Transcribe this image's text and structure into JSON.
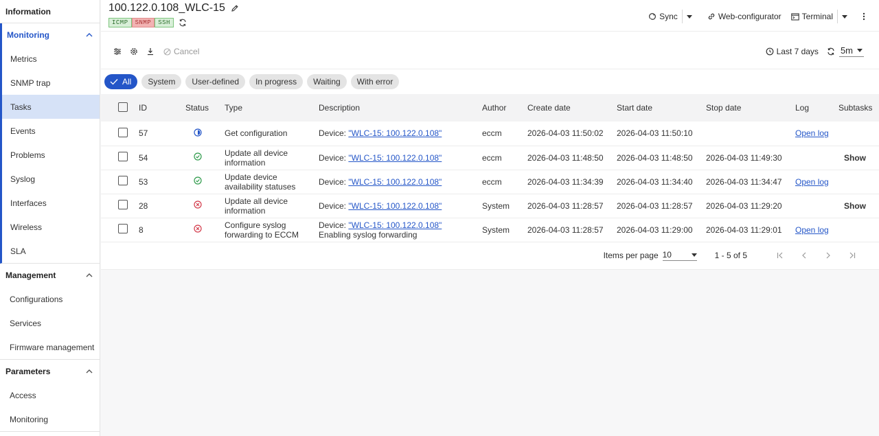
{
  "sidebar": {
    "information": "Information",
    "monitoring": {
      "title": "Monitoring",
      "items": [
        "Metrics",
        "SNMP trap",
        "Tasks",
        "Events",
        "Problems",
        "Syslog",
        "Interfaces",
        "Wireless",
        "SLA"
      ],
      "selected": "Tasks"
    },
    "management": {
      "title": "Management",
      "items": [
        "Configurations",
        "Services",
        "Firmware management"
      ]
    },
    "parameters": {
      "title": "Parameters",
      "items": [
        "Access",
        "Monitoring"
      ]
    }
  },
  "header": {
    "title": "100.122.0.108_WLC-15",
    "badges": [
      {
        "label": "ICMP",
        "status": "ok"
      },
      {
        "label": "SNMP",
        "status": "error"
      },
      {
        "label": "SSH",
        "status": "ok"
      }
    ],
    "sync_label": "Sync",
    "web_configurator_label": "Web-configurator",
    "terminal_label": "Terminal"
  },
  "toolbar": {
    "cancel_label": "Cancel",
    "period_label": "Last 7 days",
    "interval_value": "5m"
  },
  "filters": [
    "All",
    "System",
    "User-defined",
    "In progress",
    "Waiting",
    "With error"
  ],
  "active_filter": "All",
  "table": {
    "columns": [
      "ID",
      "Status",
      "Type",
      "Description",
      "Author",
      "Create date",
      "Start date",
      "Stop date",
      "Log",
      "Subtasks"
    ],
    "rows": [
      {
        "id": "57",
        "status": "in-progress",
        "type": "Get configuration",
        "desc_prefix": "Device: ",
        "desc_link": "\"WLC-15: 100.122.0.108\"",
        "desc_extra": "",
        "author": "eccm",
        "create": "2026-04-03 11:50:02",
        "start": "2026-04-03 11:50:10",
        "stop": "",
        "log": "Open log",
        "subtasks": ""
      },
      {
        "id": "54",
        "status": "success",
        "type": "Update all device information",
        "desc_prefix": "Device: ",
        "desc_link": "\"WLC-15: 100.122.0.108\"",
        "desc_extra": "",
        "author": "eccm",
        "create": "2026-04-03 11:48:50",
        "start": "2026-04-03 11:48:50",
        "stop": "2026-04-03 11:49:30",
        "log": "",
        "subtasks": "Show"
      },
      {
        "id": "53",
        "status": "success",
        "type": "Update device availability statuses",
        "desc_prefix": "Device: ",
        "desc_link": "\"WLC-15: 100.122.0.108\"",
        "desc_extra": "",
        "author": "eccm",
        "create": "2026-04-03 11:34:39",
        "start": "2026-04-03 11:34:40",
        "stop": "2026-04-03 11:34:47",
        "log": "Open log",
        "subtasks": ""
      },
      {
        "id": "28",
        "status": "error",
        "type": "Update all device information",
        "desc_prefix": "Device: ",
        "desc_link": "\"WLC-15: 100.122.0.108\"",
        "desc_extra": "",
        "author": "System",
        "create": "2026-04-03 11:28:57",
        "start": "2026-04-03 11:28:57",
        "stop": "2026-04-03 11:29:20",
        "log": "",
        "subtasks": "Show"
      },
      {
        "id": "8",
        "status": "error",
        "type": "Configure syslog forwarding to ECCM",
        "desc_prefix": "Device: ",
        "desc_link": "\"WLC-15: 100.122.0.108\"",
        "desc_extra": "Enabling syslog forwarding",
        "author": "System",
        "create": "2026-04-03 11:28:57",
        "start": "2026-04-03 11:29:00",
        "stop": "2026-04-03 11:29:01",
        "log": "Open log",
        "subtasks": ""
      }
    ]
  },
  "pagination": {
    "items_per_page_label": "Items per page",
    "items_per_page": "10",
    "range": "1 - 5 of 5"
  },
  "colors": {
    "accent": "#2456c8",
    "success": "#2e9a4a",
    "error": "#d33a4a",
    "selected_bg": "#d6e2f7"
  }
}
